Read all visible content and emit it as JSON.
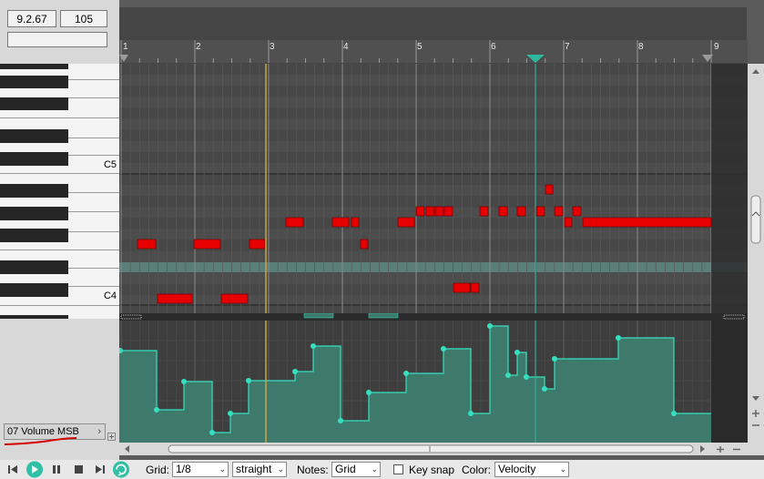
{
  "header": {
    "position": "9.2.67",
    "tempo": "105",
    "track_name": ""
  },
  "ruler": {
    "measures": [
      "1",
      "2",
      "3",
      "4",
      "5",
      "6",
      "7",
      "8",
      "9"
    ]
  },
  "keyboard": {
    "labels": [
      "C5",
      "C4"
    ]
  },
  "cc_lane": {
    "name": "07 Volume MSB"
  },
  "toolbar": {
    "grid_label": "Grid:",
    "grid_value": "1/8",
    "swing_value": "straight",
    "notes_label": "Notes:",
    "notes_value": "Grid",
    "key_snap_label": "Key snap",
    "key_snap_checked": false,
    "color_label": "Color:",
    "color_value": "Velocity"
  },
  "icons": {
    "skip_back": "skip-back-icon",
    "play": "play-icon",
    "pause": "pause-icon",
    "stop": "stop-icon",
    "skip_forward": "skip-forward-icon",
    "loop": "loop-icon"
  },
  "colors": {
    "note": "#e60000",
    "cc_fill": "#3d7a6c",
    "cc_line": "#35e0c0",
    "cursor": "#c9a54a",
    "playhead": "#2fb8a0"
  }
}
